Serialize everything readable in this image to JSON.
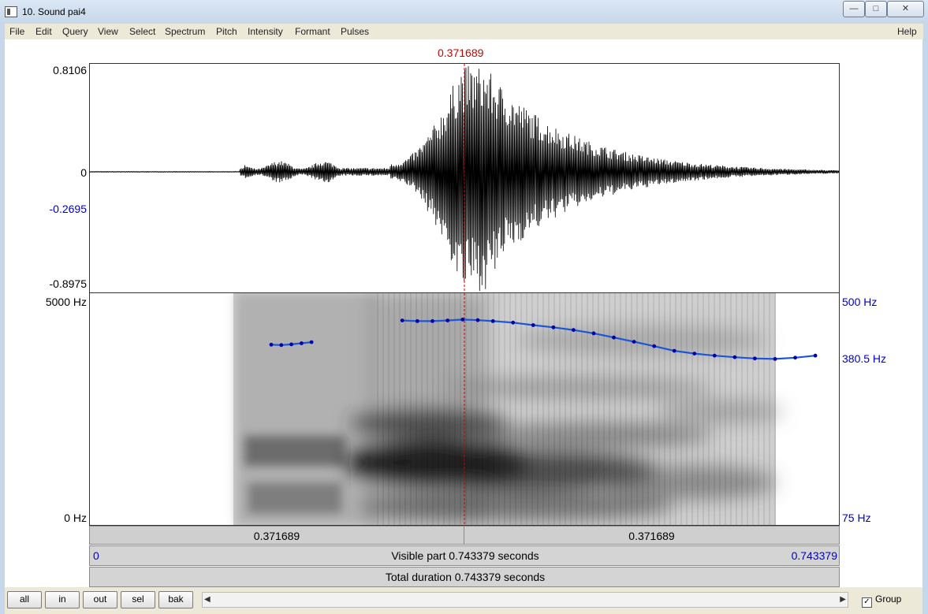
{
  "window": {
    "title": "10. Sound pai4",
    "buttons": {
      "minimize": "—",
      "maximize": "□",
      "close": "✕"
    }
  },
  "menu": [
    "File",
    "Edit",
    "Query",
    "View",
    "Select",
    "Spectrum",
    "Pitch",
    "Intensity",
    "Formant",
    "Pulses"
  ],
  "help": "Help",
  "cursor": {
    "time": "0.371689"
  },
  "waveform": {
    "y_max": "0.8106",
    "y_zero": "0",
    "y_cursor": "-0.2695",
    "y_min": "-0.8975"
  },
  "spectrogram": {
    "freq_max": "5000 Hz",
    "freq_min": "0 Hz"
  },
  "pitch_axis": {
    "max": "500 Hz",
    "cursor": "380.5 Hz",
    "min": "75 Hz"
  },
  "time_bar": {
    "left": "0.371689",
    "right": "0.371689"
  },
  "visible_bar": {
    "start": "0",
    "label": "Visible part 0.743379 seconds",
    "end": "0.743379"
  },
  "total_bar": {
    "label": "Total duration 0.743379 seconds"
  },
  "buttons": {
    "all": "all",
    "in": "in",
    "out": "out",
    "sel": "sel",
    "bak": "bak"
  },
  "group": {
    "label": "Group",
    "checked": true
  },
  "colors": {
    "cursor": "#c80000",
    "pitch": "#0000c8",
    "pitch_line": "#1a56d6"
  },
  "pitch_contours": [
    {
      "t": [
        0.18,
        0.19,
        0.2,
        0.21,
        0.22
      ],
      "hz": [
        328,
        327,
        329,
        332,
        335
      ]
    },
    {
      "t": [
        0.31,
        0.325,
        0.34,
        0.355,
        0.37,
        0.385,
        0.4,
        0.42,
        0.44,
        0.46,
        0.48,
        0.5,
        0.52,
        0.54,
        0.56,
        0.58,
        0.6,
        0.62,
        0.64,
        0.66,
        0.68,
        0.7,
        0.72
      ],
      "hz": [
        400,
        398,
        398,
        400,
        403,
        401,
        398,
        393,
        385,
        378,
        370,
        360,
        348,
        336,
        324,
        312,
        305,
        300,
        296,
        293,
        292,
        295,
        300
      ]
    }
  ]
}
